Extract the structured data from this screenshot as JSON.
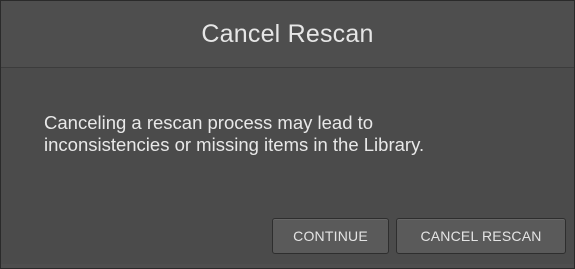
{
  "dialog": {
    "title": "Cancel Rescan",
    "message_line1": "Canceling a rescan process may lead to",
    "message_line2": "inconsistencies or missing items in the Library.",
    "buttons": {
      "continue_label": "CONTINUE",
      "cancel_rescan_label": "CANCEL RESCAN"
    }
  },
  "colors": {
    "background": "#4e4e4e",
    "text": "#e6e6e6",
    "button": "#5a5a5a"
  }
}
